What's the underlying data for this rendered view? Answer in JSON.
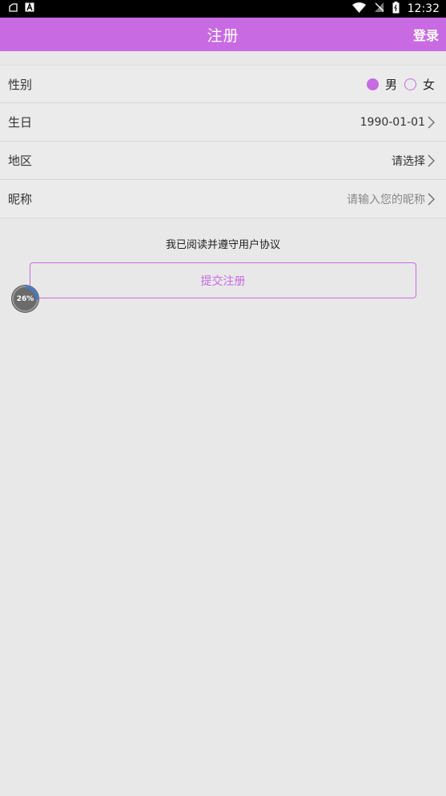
{
  "status_bar": {
    "time": "12:32",
    "icons": [
      "notification-icon",
      "a-icon",
      "wifi-icon",
      "no-sim-icon",
      "battery-icon"
    ]
  },
  "app_bar": {
    "title": "注册",
    "login_label": "登录"
  },
  "form": {
    "gender": {
      "label": "性别",
      "options": [
        "男",
        "女"
      ],
      "selected": "男"
    },
    "birthday": {
      "label": "生日",
      "value": "1990-01-01"
    },
    "region": {
      "label": "地区",
      "value": "请选择"
    },
    "nickname": {
      "label": "昵称",
      "placeholder": "请输入您的昵称"
    }
  },
  "agreement_text": "我已阅读并遵守用户协议",
  "submit_label": "提交注册",
  "progress": {
    "label": "26%",
    "value": 0.26
  },
  "colors": {
    "accent": "#c86ae2",
    "background": "#e8e8e8"
  }
}
